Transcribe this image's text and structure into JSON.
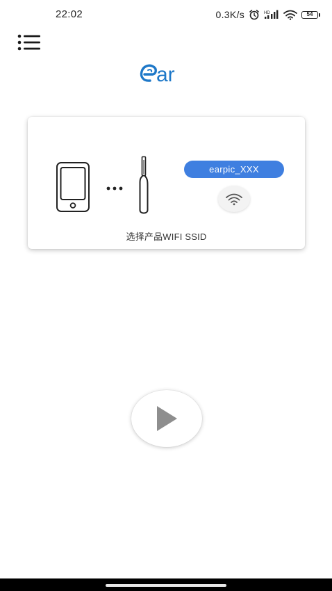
{
  "status_bar": {
    "time": "22:02",
    "net_speed": "0.3K/s",
    "battery_level": "54",
    "icons": [
      "alarm-icon",
      "signal-icon",
      "wifi-icon",
      "battery-icon"
    ]
  },
  "header": {
    "menu_icon": "menu-icon",
    "logo_text": "ear",
    "logo_color": "#1e78c8"
  },
  "card": {
    "ssid_label": "earpic_XXX",
    "caption": "选择产品WIFI SSID",
    "ssid_pill_color": "#3f7fe0",
    "icons": [
      "phone-icon",
      "connection-dots-icon",
      "earpick-device-icon",
      "wifi-icon"
    ]
  },
  "main": {
    "play_icon": "play-icon"
  }
}
